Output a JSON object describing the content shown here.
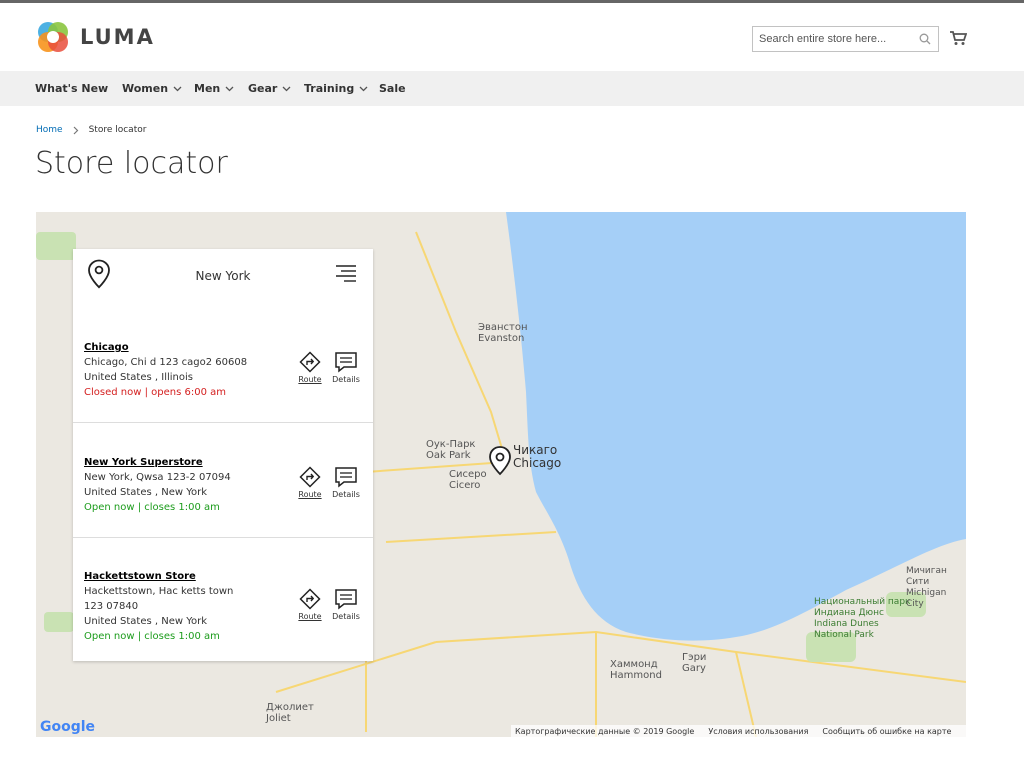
{
  "brand": {
    "name": "LUMA"
  },
  "search": {
    "placeholder": "Search entire store here..."
  },
  "nav": {
    "items": [
      "What's New",
      "Women",
      "Men",
      "Gear",
      "Training",
      "Sale"
    ]
  },
  "breadcrumb": {
    "home": "Home",
    "current": "Store locator"
  },
  "page": {
    "title": "Store locator"
  },
  "panel": {
    "city": "New York"
  },
  "stores": [
    {
      "name": "Chicago",
      "line1": "Chicago, Chi d 123 cago2 60608",
      "line2": "",
      "line3": "United States , Illinois",
      "status": "Closed now | opens 6:00 am",
      "route": "Route",
      "details": "Details"
    },
    {
      "name": "New York Superstore",
      "line1": "New York, Qwsa 123-2 07094",
      "line2": "",
      "line3": "United States , New York",
      "status": "Open now | closes 1:00 am",
      "route": "Route",
      "details": "Details"
    },
    {
      "name": "Hackettstown Store",
      "line1": "Hackettstown, Hac ketts town",
      "line2": "123 07840",
      "line3": "United States , New York",
      "status": "Open now | closes 1:00 am",
      "route": "Route",
      "details": "Details"
    }
  ],
  "map": {
    "labels": {
      "chicago_ru": "Чикаго",
      "chicago": "Chicago",
      "evanston_ru": "Эванстон",
      "evanston": "Evanston",
      "oak_park_ru": "Оук-Парк",
      "oak_park": "Oak Park",
      "cicero_ru": "Сисеро",
      "cicero": "Cicero",
      "gary_ru": "Гэри",
      "gary": "Gary",
      "hammond_ru": "Хаммонд",
      "hammond": "Hammond",
      "dunes_ru": "Национальный парк Индиана Дюнс",
      "dunes": "Indiana Dunes National Park",
      "michigan_city_ru": "Мичиган Сити",
      "michigan_city": "Michigan City",
      "joliet_ru": "Джолиет",
      "joliet": "Joliet"
    },
    "google": "Google",
    "attribution": [
      "Картографические данные © 2019 Google",
      "Условия использования",
      "Сообщить об ошибке на карте"
    ]
  }
}
